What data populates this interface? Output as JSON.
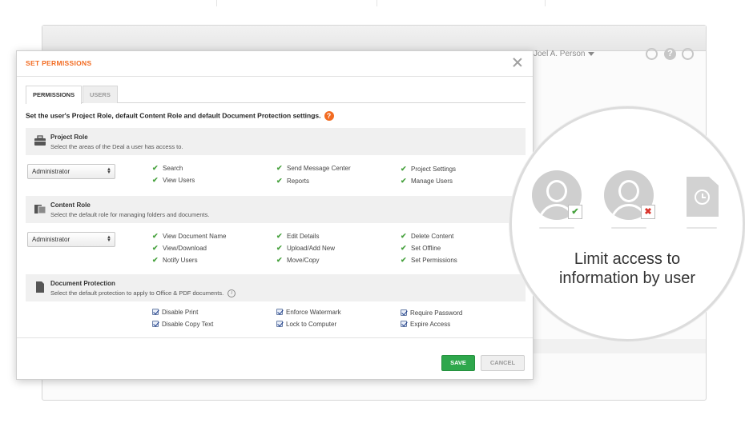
{
  "background": {
    "user_name": "Joel A. Person",
    "help_glyph": "?"
  },
  "modal": {
    "title": "SET PERMISSIONS",
    "tabs": [
      {
        "label": "PERMISSIONS",
        "active": true
      },
      {
        "label": "USERS",
        "active": false
      }
    ],
    "instruction": "Set the user's Project Role, default Content Role and default Document Protection settings.",
    "help_glyph": "?",
    "project_role": {
      "title": "Project Role",
      "subtitle": "Select the areas of the Deal a user has access to.",
      "selected": "Administrator",
      "permissions": [
        "Search",
        "Send Message Center",
        "Project Settings",
        "View Users",
        "Reports",
        "Manage Users"
      ]
    },
    "content_role": {
      "title": "Content Role",
      "subtitle": "Select the default role for managing folders and documents.",
      "selected": "Administrator",
      "permissions": [
        "View Document Name",
        "Edit Details",
        "Delete Content",
        "View/Download",
        "Upload/Add New",
        "Set Offline",
        "Notify Users",
        "Move/Copy",
        "Set Permissions"
      ]
    },
    "document_protection": {
      "title": "Document Protection",
      "subtitle": "Select the default protection to apply to Office & PDF documents.",
      "info_glyph": "i",
      "options": [
        {
          "label": "Disable Print",
          "checked": true
        },
        {
          "label": "Enforce Watermark",
          "checked": true
        },
        {
          "label": "Require Password",
          "checked": true
        },
        {
          "label": "Disable Copy Text",
          "checked": true
        },
        {
          "label": "Lock to Computer",
          "checked": true
        },
        {
          "label": "Expire Access",
          "checked": true
        }
      ]
    },
    "save_label": "SAVE",
    "cancel_label": "CANCEL"
  },
  "callout": {
    "line1": "Limit access to",
    "line2": "information by user",
    "allowed_mark": "✔",
    "denied_mark": "✖"
  },
  "colors": {
    "accent_orange": "#f26b21",
    "save_green": "#2ea74c",
    "check_green": "#48a23f",
    "deny_red": "#d9342b"
  }
}
